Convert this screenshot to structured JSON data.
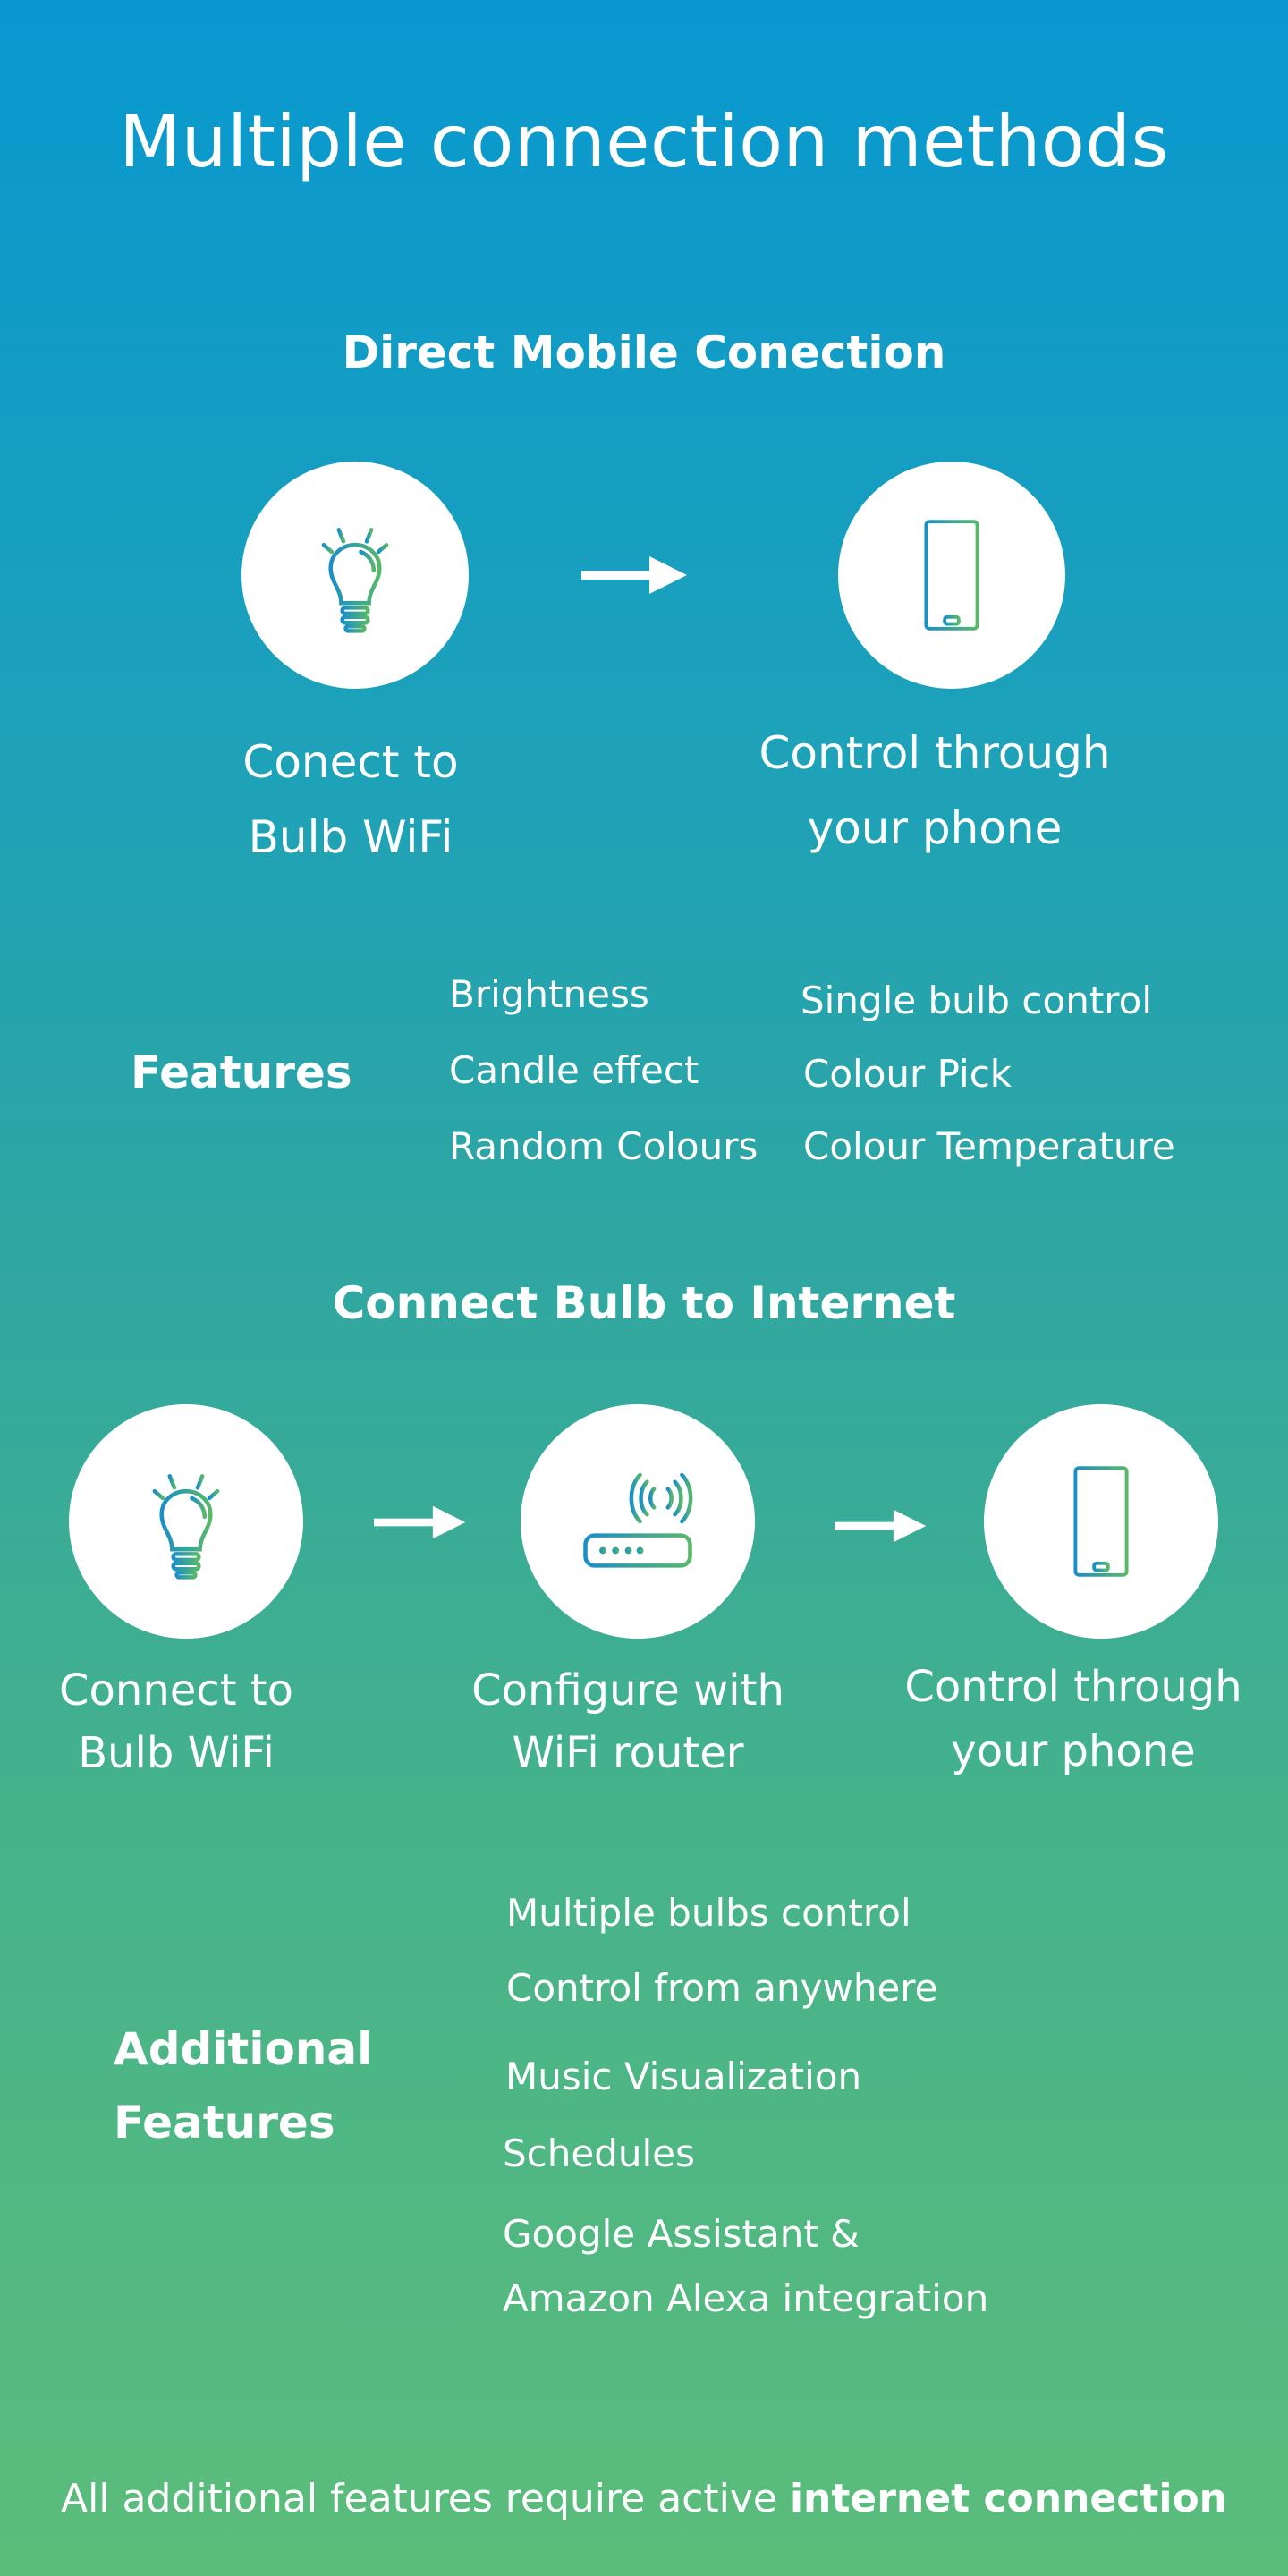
{
  "page": {
    "title": "Multiple connection methods",
    "colors": {
      "top": "#0898d0",
      "middle": "#2ea6a2",
      "bottom": "#5cbd7a",
      "icon_start": "#1a8fc8",
      "icon_end": "#58b86a"
    }
  },
  "section1": {
    "heading": "Direct Mobile Conection",
    "steps": [
      {
        "icon": "lightbulb-icon",
        "label_line1": "Conect to",
        "label_line2": "Bulb WiFi"
      },
      {
        "icon": "smartphone-icon",
        "label_line1": "Control through",
        "label_line2": "your phone"
      }
    ],
    "features_label": "Features",
    "features_col1": [
      "Brightness",
      "Candle effect",
      "Random Colours"
    ],
    "features_col2": [
      "Single bulb control",
      "Colour Pick",
      "Colour Temperature"
    ]
  },
  "section2": {
    "heading": "Connect Bulb to Internet",
    "steps": [
      {
        "icon": "lightbulb-icon",
        "label_line1": "Connect to",
        "label_line2": "Bulb WiFi"
      },
      {
        "icon": "wifi-router-icon",
        "label_line1": "Configure with",
        "label_line2": "WiFi router"
      },
      {
        "icon": "smartphone-icon",
        "label_line1": "Control through",
        "label_line2": "your phone"
      }
    ],
    "features_label_line1": "Additional",
    "features_label_line2": "Features",
    "features": [
      "Multiple bulbs control",
      "Control from anywhere",
      "Music Visualization",
      "Schedules",
      "Google Assistant &",
      "Amazon Alexa integration"
    ]
  },
  "footer": {
    "text_regular": "All additional features require active ",
    "text_bold": "internet connection"
  }
}
